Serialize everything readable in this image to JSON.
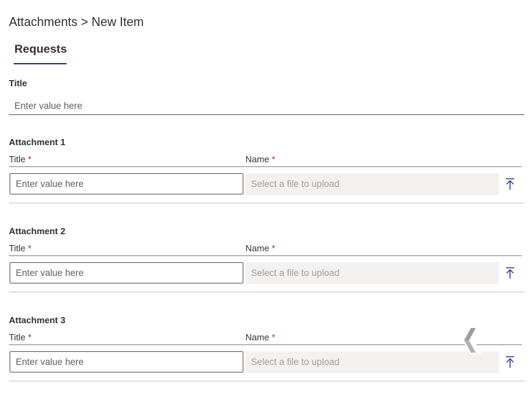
{
  "breadcrumb": "Attachments > New Item",
  "tab": {
    "label": "Requests"
  },
  "title_field": {
    "label": "Title",
    "placeholder": "Enter value here"
  },
  "attachments": [
    {
      "heading": "Attachment 1",
      "title_label": "Title",
      "name_label": "Name",
      "required_mark": "*",
      "title_placeholder": "Enter value here",
      "file_placeholder": "Select a file to upload",
      "upload_icon": "upload-icon"
    },
    {
      "heading": "Attachment 2",
      "title_label": "Title",
      "name_label": "Name",
      "required_mark": "*",
      "title_placeholder": "Enter value here",
      "file_placeholder": "Select a file to upload",
      "upload_icon": "upload-icon"
    },
    {
      "heading": "Attachment 3",
      "title_label": "Title",
      "name_label": "Name",
      "required_mark": "*",
      "title_placeholder": "Enter value here",
      "file_placeholder": "Select a file to upload",
      "upload_icon": "upload-icon"
    }
  ],
  "colors": {
    "accent": "#2b3990",
    "required": "#a4262c",
    "file_box_bg": "#f3f2f1"
  }
}
